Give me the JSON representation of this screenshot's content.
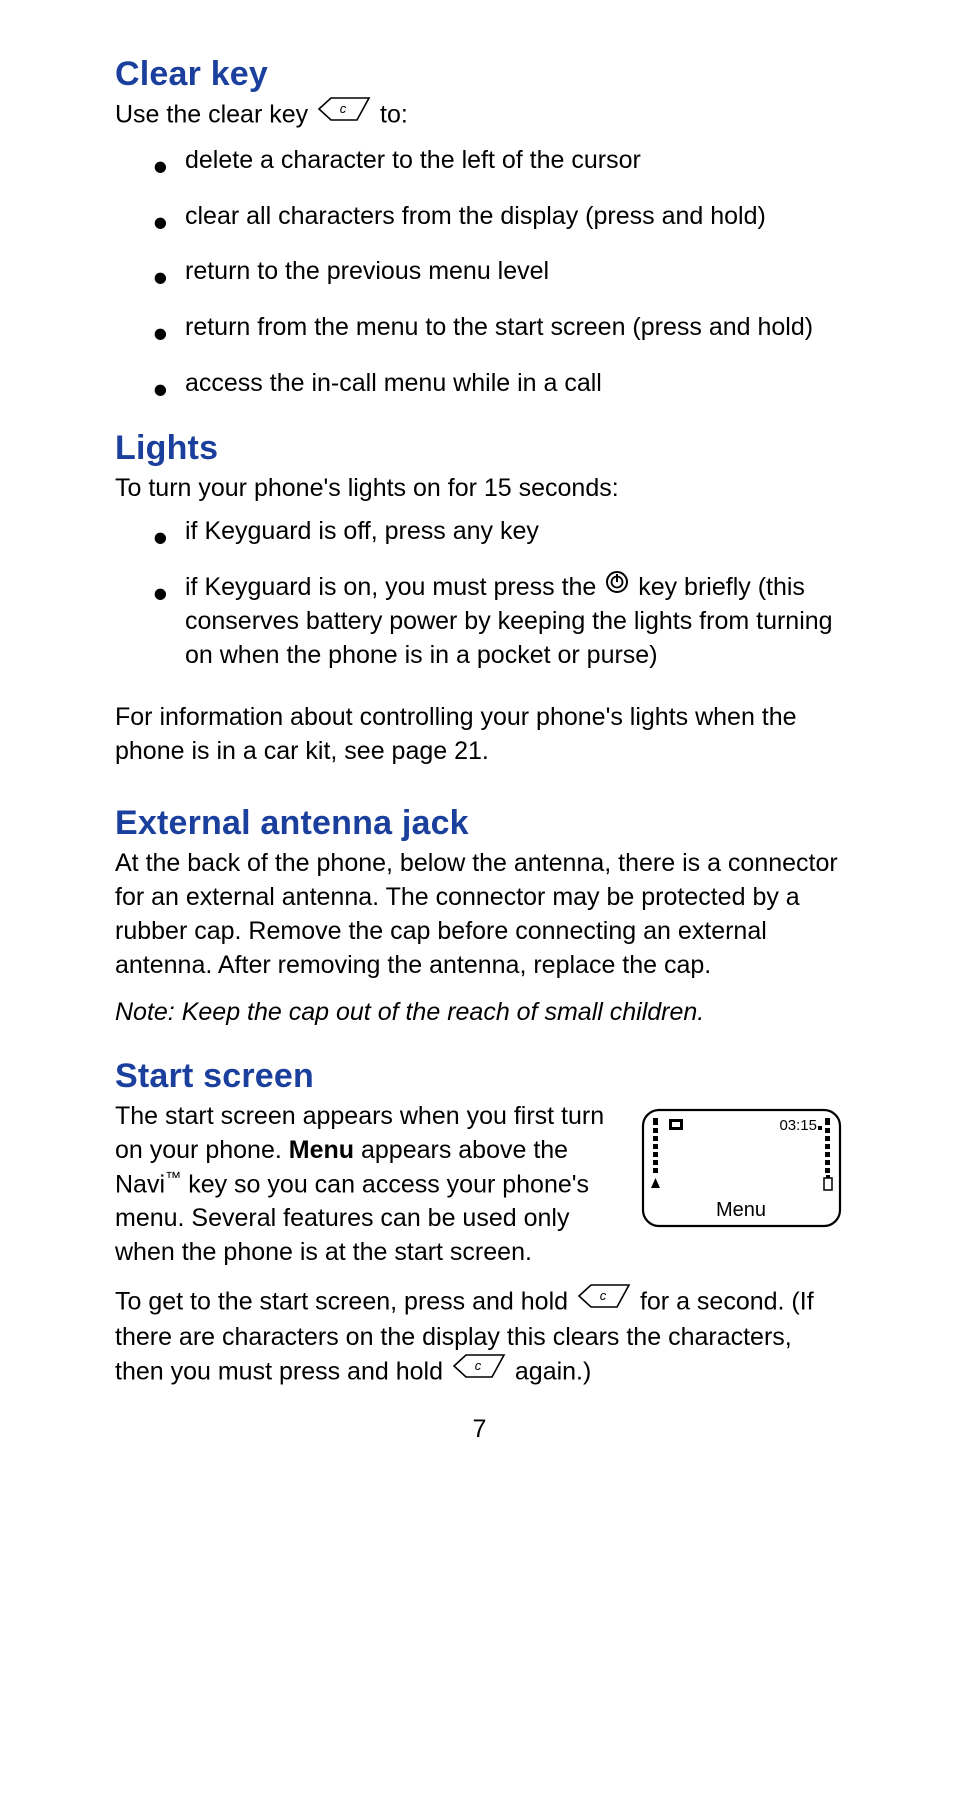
{
  "page_number": "7",
  "sections": {
    "clear_key": {
      "heading": "Clear key",
      "intro_pre": "Use the clear key ",
      "intro_post": " to:",
      "bullets": [
        "delete a character to the left of the cursor",
        "clear all characters from the display (press and hold)",
        "return to the previous menu level",
        "return from the menu to the start screen (press and hold)",
        "access the in-call menu while in a call"
      ]
    },
    "lights": {
      "heading": "Lights",
      "intro": "To turn your phone's lights on for 15 seconds:",
      "bullets_plain": [
        "if Keyguard is off, press any key"
      ],
      "bullet2_pre": "if Keyguard is on, you must press the ",
      "bullet2_post": " key briefly (this conserves battery power by keeping the lights from turning on when the phone is in a pocket or purse)",
      "para": "For information about controlling your phone's lights when the phone is in a car kit, see page 21."
    },
    "antenna": {
      "heading": "External antenna jack",
      "para": "At the back of the phone, below the antenna, there is a con­nector for an external antenna. The connector may be pro­tected by a rubber cap. Remove the cap before connecting an external antenna. After removing the antenna, replace the cap.",
      "note_label": "Note:",
      "note_body": " Keep the cap out of the reach of small children."
    },
    "start_screen": {
      "heading": "Start screen",
      "para1_a": "The start screen appears when you first turn on your phone. ",
      "para1_bold": "Menu",
      "para1_b": " appears above the Navi",
      "para1_tm": "™",
      "para1_c": " key so you can access your phone's menu. Several features can be used only when the phone is at the start screen.",
      "para2_a": "To get to the start screen, press and hold ",
      "para2_b": " for a second. (If there are characters on the display this clears the characters, then you must press and hold ",
      "para2_c": " again.)",
      "phone_display": {
        "time": "03:15",
        "softkey": "Menu"
      }
    }
  },
  "icons": {
    "clear_key_letter": "c"
  }
}
